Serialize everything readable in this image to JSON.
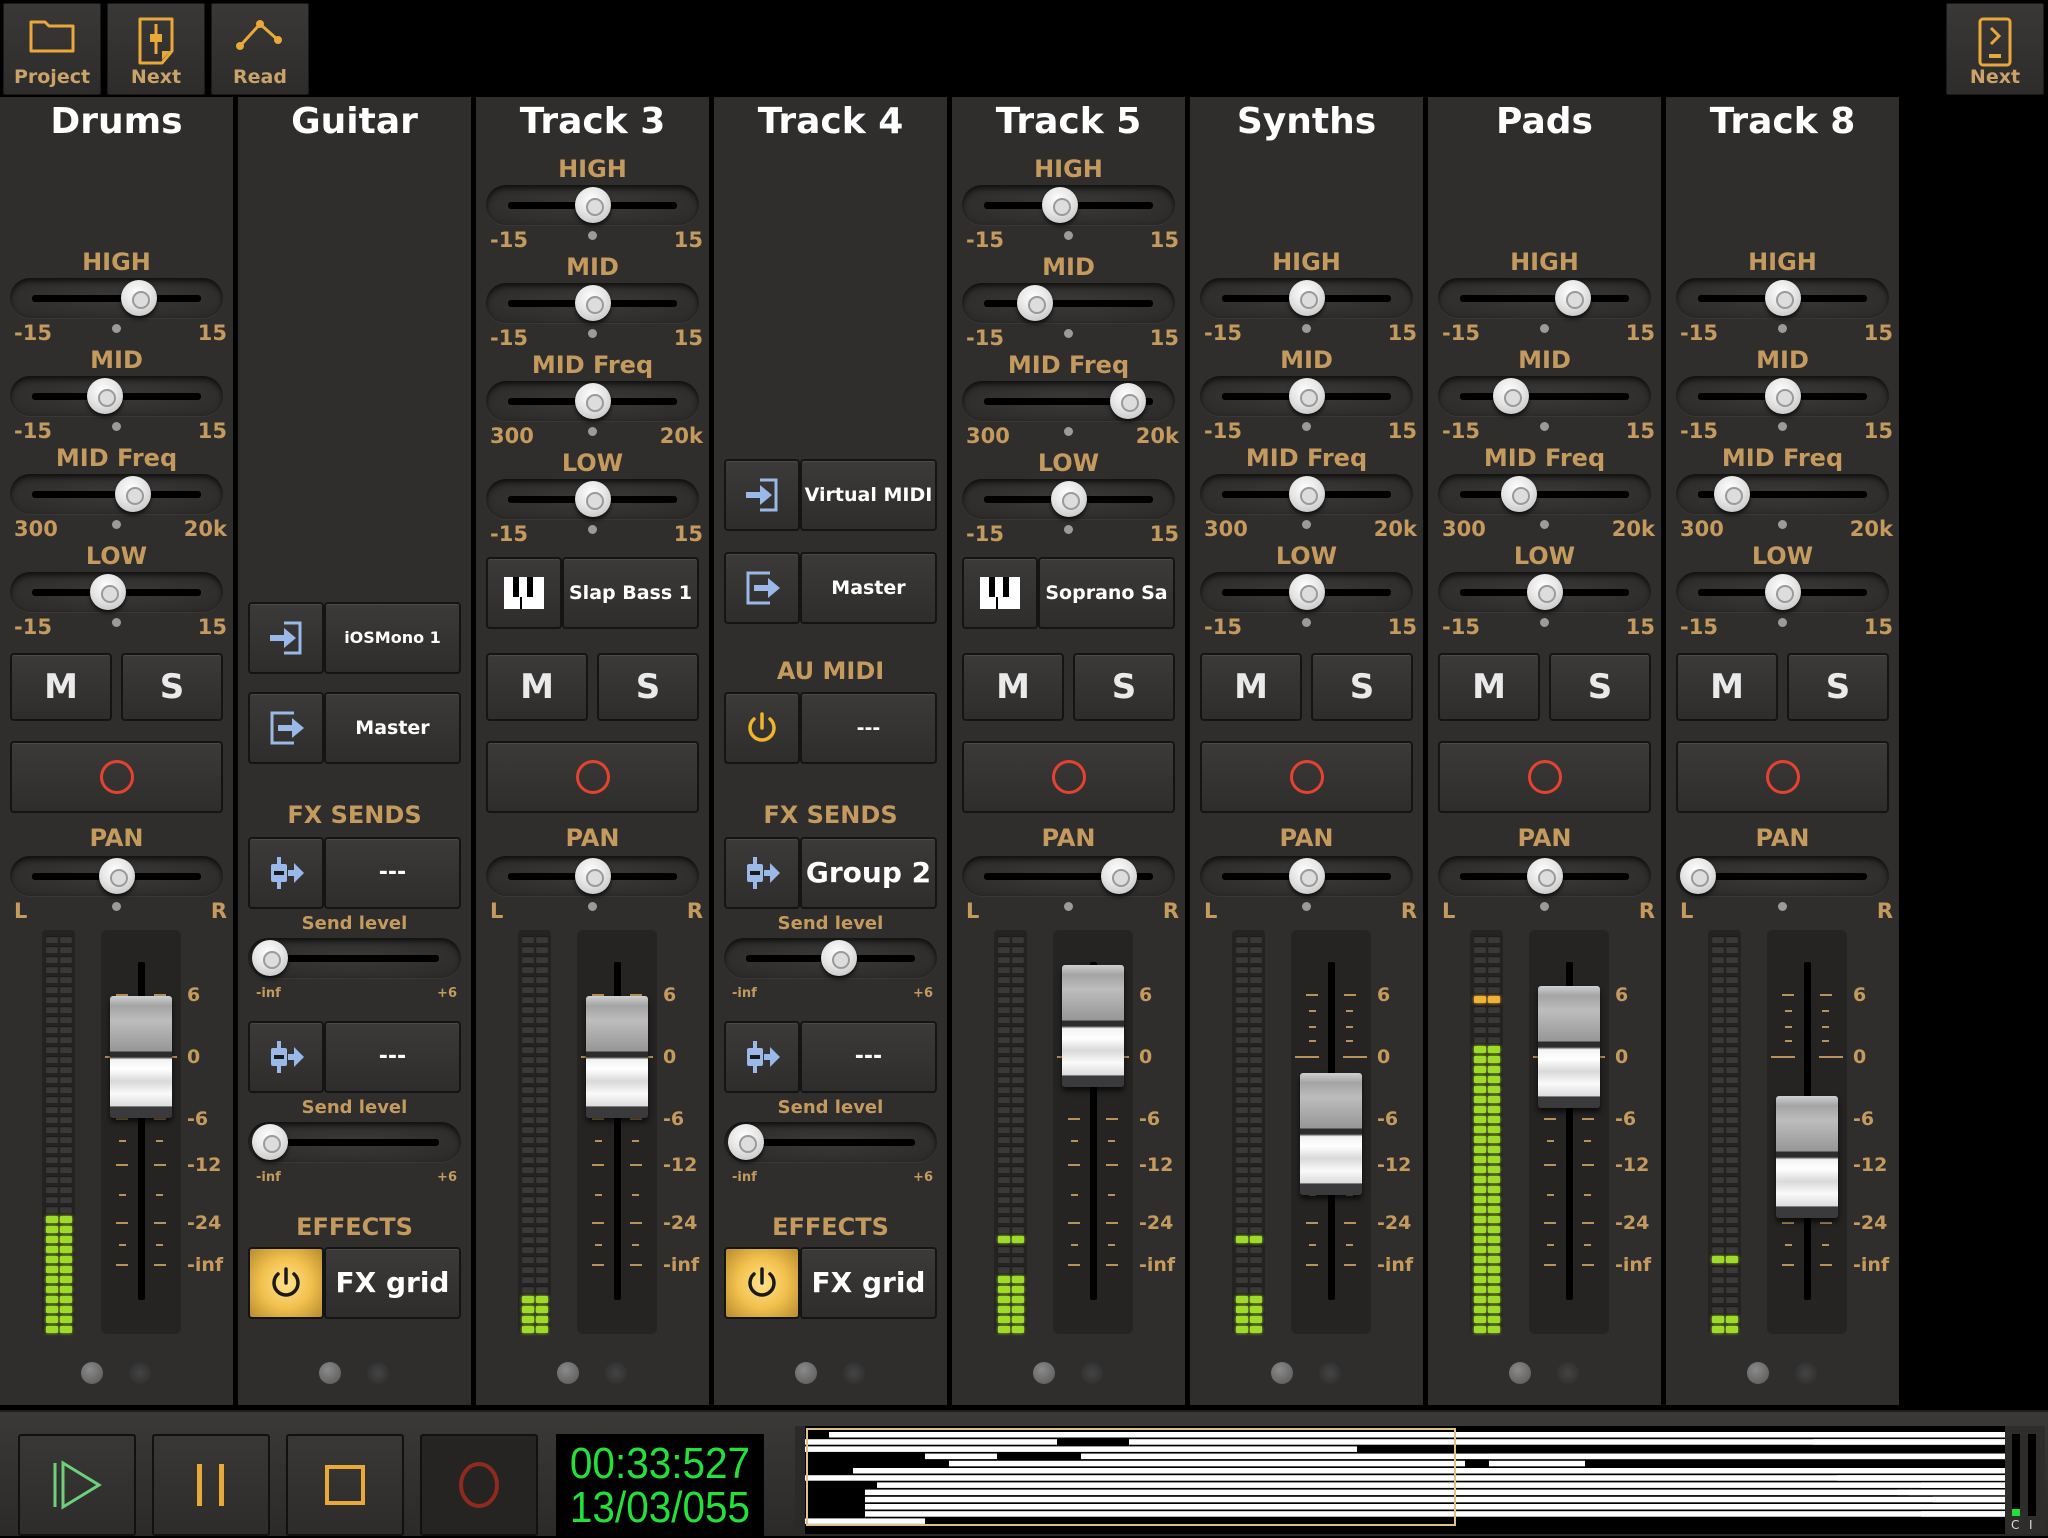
{
  "toolbar": {
    "project_label": "Project",
    "next_label": "Next",
    "read_label": "Read",
    "next_right_label": "Next"
  },
  "eq_labels": {
    "high": "HIGH",
    "mid": "MID",
    "mid_freq": "MID Freq",
    "low": "LOW",
    "gain_min": "-15",
    "gain_max": "15",
    "freq_min": "300",
    "freq_max": "20k",
    "pan": "PAN",
    "pan_left": "L",
    "pan_right": "R",
    "mute": "M",
    "solo": "S",
    "fx_sends": "FX SENDS",
    "send_level": "Send level",
    "send_min": "-inf",
    "send_max": "+6",
    "effects": "EFFECTS",
    "au_midi": "AU MIDI"
  },
  "fader_scale": [
    "6",
    "0",
    "-6",
    "-12",
    "-24",
    "-inf"
  ],
  "channels": [
    {
      "name": "Drums",
      "eq": {
        "high": 4,
        "mid": -2,
        "mid_freq": 0.6,
        "low": -1.5
      },
      "pan": 0.0,
      "fader_db": 0,
      "meter_lit": 12,
      "meter_peak": null
    },
    {
      "name": "Guitar",
      "input": {
        "line1": "iOS",
        "line2": "Mono 1"
      },
      "output": "Master",
      "sends": [
        {
          "target": "---",
          "level": 0.0
        },
        {
          "target": "---",
          "level": 0.0
        }
      ],
      "effects": "FX grid",
      "effects_on": true
    },
    {
      "name": "Track 3",
      "eq": {
        "high": 0,
        "mid": 0,
        "mid_freq": 0.5,
        "low": 0
      },
      "instrument": "Slap Bass 1",
      "pan": 0.0,
      "fader_db": 0,
      "meter_lit": 4,
      "meter_peak": null
    },
    {
      "name": "Track 4",
      "input": {
        "line1": "Virtual MIDI"
      },
      "output": "Master",
      "au_midi": "---",
      "au_midi_on": true,
      "sends": [
        {
          "target": "Group 2",
          "level": 0.55
        },
        {
          "target": "---",
          "level": 0.0
        }
      ],
      "effects": "FX grid",
      "effects_on": true
    },
    {
      "name": "Track 5",
      "eq": {
        "high": -1.5,
        "mid": -6,
        "mid_freq": 0.85,
        "low": 0
      },
      "instrument": "Soprano Sa",
      "pan": 0.6,
      "fader_db": 3,
      "meter_lit": 6,
      "meter_peak": 9
    },
    {
      "name": "Synths",
      "eq": {
        "high": 0,
        "mid": 0,
        "mid_freq": 0.5,
        "low": 0
      },
      "pan": 0.0,
      "fader_db": -8,
      "meter_lit": 4,
      "meter_peak": 9
    },
    {
      "name": "Pads",
      "eq": {
        "high": 5,
        "mid": -6,
        "mid_freq": 0.35,
        "low": 0
      },
      "pan": 0.0,
      "fader_db": 1,
      "meter_lit": 29,
      "meter_peak": 33
    },
    {
      "name": "Track 8",
      "eq": {
        "high": 0,
        "mid": 0,
        "mid_freq": 0.2,
        "low": 0
      },
      "pan": -1.0,
      "fader_db": -11,
      "meter_lit": 2,
      "meter_peak": 7
    }
  ],
  "transport": {
    "time": "00:33:527",
    "bars": "13/03/055",
    "meter_labels": [
      "C",
      "I"
    ]
  },
  "overview": {
    "rows": [
      [
        [
          0.02,
          1.0
        ],
        [
          1.0,
          1.0
        ]
      ],
      [
        [
          0.0,
          0.21
        ],
        [
          0.27,
          1.0
        ],
        [
          1.0,
          0.84
        ]
      ],
      [
        [
          0.0,
          0.24
        ],
        [
          0.24,
          0.46
        ]
      ],
      [
        [
          0.1,
          0.16
        ],
        [
          0.23,
          1.0
        ],
        [
          1.0,
          0.57
        ]
      ],
      [
        [
          0.12,
          0.55
        ],
        [
          0.65,
          0.57
        ]
      ],
      [
        [
          0.04,
          1.0
        ],
        [
          1.0,
          0.86
        ],
        [
          0.87,
          0.93
        ]
      ],
      [
        [
          0.0,
          1.0
        ],
        [
          1.0,
          0.86
        ]
      ],
      [
        [
          0.06,
          1.0
        ],
        [
          1.0,
          0.93
        ]
      ],
      [
        [
          0.05,
          1.0
        ],
        [
          1.0,
          0.91
        ],
        [
          0.92,
          1.0
        ]
      ],
      [
        [
          0.05,
          1.0
        ],
        [
          1.0,
          0.94
        ]
      ],
      [
        [
          0.05,
          1.0
        ],
        [
          1.0,
          0.97
        ]
      ],
      [
        [
          0.05,
          1.0
        ],
        [
          1.0,
          0.93
        ]
      ],
      [
        [
          0.0,
          0.1
        ]
      ]
    ],
    "loop_end": 0.54
  }
}
